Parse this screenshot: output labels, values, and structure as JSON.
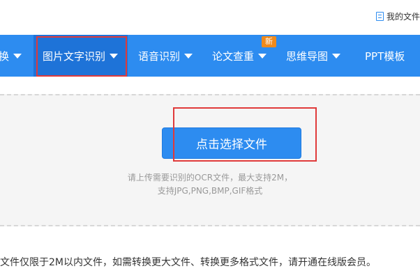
{
  "header": {
    "my_files_label": "我的文件"
  },
  "nav": {
    "items": [
      {
        "label": "换"
      },
      {
        "label": "图片文字识别"
      },
      {
        "label": "语音识别"
      },
      {
        "label": "论文查重"
      },
      {
        "label": "思维导图"
      },
      {
        "label": "PPT模板"
      }
    ],
    "badge": "新"
  },
  "upload": {
    "button_label": "点击选择文件",
    "hint_line1": "请上传需要识别的OCR文件，最大支持2M，",
    "hint_line2": "支持JPG,PNG,BMP,GIF格式"
  },
  "footer_note": "文件仅限于2M以内文件，如需转换更大文件、转换更多格式文件，请开通在线版会员。",
  "colors": {
    "nav_bg": "#2d8cf0",
    "active_tab": "#1e73d8",
    "badge": "#f08a1c",
    "highlight": "#e03a3a"
  }
}
